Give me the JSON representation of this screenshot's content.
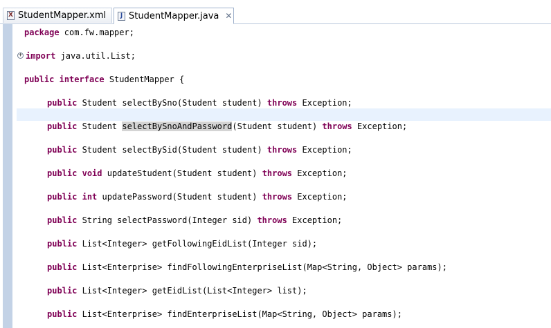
{
  "tabs": [
    {
      "label": "StudentMapper.xml",
      "icon": "xml-file-icon",
      "active": false
    },
    {
      "label": "StudentMapper.java",
      "icon": "java-file-icon",
      "active": true,
      "close_glyph": "✕"
    }
  ],
  "colors": {
    "keyword": "#7f0055",
    "ruler": "#c3d2e6",
    "current_line": "#e8f2fe",
    "occurrence_highlight": "#d4d4d4"
  },
  "code": {
    "package": {
      "kw": "package",
      "rest": " com.fw.mapper;"
    },
    "import": {
      "kw": "import",
      "rest": " java.util.List;",
      "fold": "+"
    },
    "interface": {
      "kw1": "public",
      "kw2": "interface",
      "rest": " StudentMapper {"
    },
    "methods": [
      {
        "kw": "public",
        "pre": " Student selectBySno(Student student) ",
        "throws": "throws",
        "post": " Exception;"
      },
      {
        "kw": "public",
        "pre": " Student ",
        "highlight": "selectBySnoAndPassword",
        "mid": "(Student student) ",
        "throws": "throws",
        "post": " Exception;"
      },
      {
        "kw": "public",
        "pre": " Student selectBySid(Student student) ",
        "throws": "throws",
        "post": " Exception;"
      },
      {
        "kw": "public",
        "kw2": "void",
        "pre": " updateStudent(Student student) ",
        "throws": "throws",
        "post": " Exception;"
      },
      {
        "kw": "public",
        "kw2": "int",
        "pre": " updatePassword(Student student) ",
        "throws": "throws",
        "post": " Exception;"
      },
      {
        "kw": "public",
        "pre": " String selectPassword(Integer sid) ",
        "throws": "throws",
        "post": " Exception;"
      },
      {
        "kw": "public",
        "pre": " List<Integer> getFollowingEidList(Integer sid);"
      },
      {
        "kw": "public",
        "pre": " List<Enterprise> findFollowingEnterpriseList(Map<String, Object> params);"
      },
      {
        "kw": "public",
        "pre": " List<Integer> getEidList(List<Integer> list);"
      },
      {
        "kw": "public",
        "pre": " List<Enterprise> findEnterpriseList(Map<String, Object> params);"
      }
    ]
  }
}
